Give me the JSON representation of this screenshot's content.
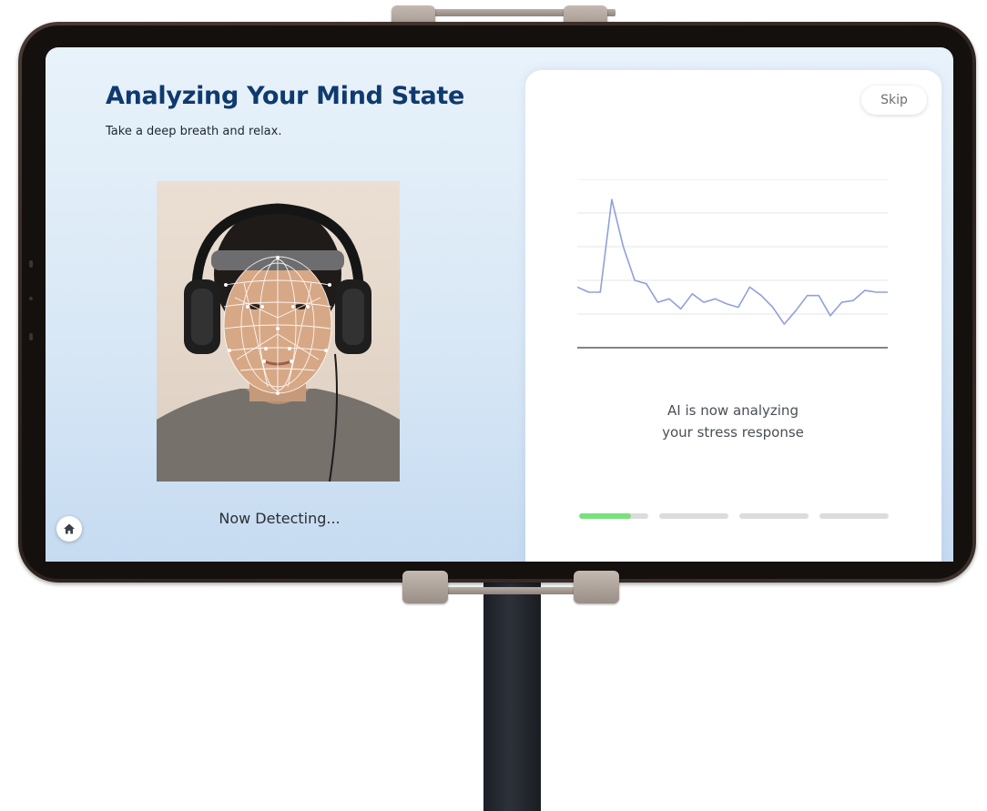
{
  "screen": {
    "title": "Analyzing Your Mind State",
    "subtitle": "Take a deep breath and relax.",
    "status_text": "Now Detecting...",
    "home_icon": "home-icon"
  },
  "card": {
    "skip_label": "Skip",
    "analysis_line1": "AI is now analyzing",
    "analysis_line2": "your stress response",
    "progress": {
      "steps": 4,
      "current_step_fill": 0.75,
      "fill_color": "#7ae07c",
      "track_color": "#dcdcdc"
    }
  },
  "chart_data": {
    "type": "line",
    "title": "",
    "xlabel": "",
    "ylabel": "",
    "grid": true,
    "ylim": [
      0,
      10
    ],
    "series": [
      {
        "color": "#8fa0dc",
        "x": [
          0,
          1,
          2,
          3,
          4,
          5,
          6,
          7,
          8,
          9,
          10,
          11,
          12,
          13,
          14,
          15,
          16,
          17,
          18,
          19,
          20,
          21,
          22,
          23,
          24,
          25,
          26,
          27
        ],
        "values": [
          3.6,
          3.3,
          3.3,
          8.8,
          6.0,
          4.0,
          3.8,
          2.7,
          2.9,
          2.3,
          3.2,
          2.7,
          2.9,
          2.6,
          2.4,
          3.6,
          3.1,
          2.4,
          1.4,
          2.2,
          3.1,
          3.1,
          1.9,
          2.7,
          2.8,
          3.4,
          3.3,
          3.3
        ]
      }
    ]
  }
}
